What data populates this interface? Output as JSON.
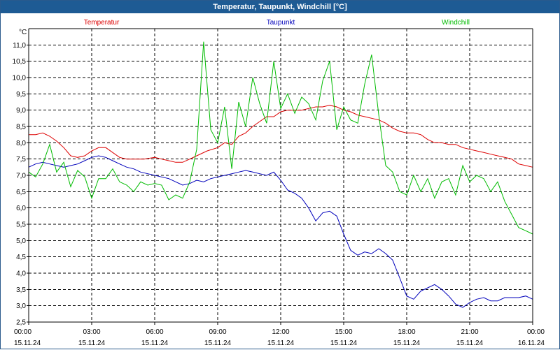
{
  "window": {
    "title": "Temperatur, Taupunkt, Windchill [°C]"
  },
  "chart_data": {
    "type": "line",
    "title": "Temperatur, Taupunkt, Windchill [°C]",
    "ylabel": "°C",
    "xlabel": "",
    "ylim": [
      2.5,
      11.5
    ],
    "xlim": [
      0,
      24
    ],
    "grid": true,
    "legend_placement": "top",
    "y_ticks": [
      "2,5",
      "3,0",
      "3,5",
      "4,0",
      "4,5",
      "5,0",
      "5,5",
      "6,0",
      "6,5",
      "7,0",
      "7,5",
      "8,0",
      "8,5",
      "9,0",
      "9,5",
      "10,0",
      "10,5",
      "11,0"
    ],
    "x_ticks": [
      {
        "time": "00:00",
        "date": "15.11.24"
      },
      {
        "time": "03:00",
        "date": "15.11.24"
      },
      {
        "time": "06:00",
        "date": "15.11.24"
      },
      {
        "time": "09:00",
        "date": "15.11.24"
      },
      {
        "time": "12:00",
        "date": "15.11.24"
      },
      {
        "time": "15:00",
        "date": "15.11.24"
      },
      {
        "time": "18:00",
        "date": "15.11.24"
      },
      {
        "time": "21:00",
        "date": "15.11.24"
      },
      {
        "time": "00:00",
        "date": "16.11.24"
      }
    ],
    "series": [
      {
        "name": "Temperatur",
        "color": "#dd0000",
        "points": [
          [
            0,
            8.25
          ],
          [
            0.33,
            8.25
          ],
          [
            0.67,
            8.3
          ],
          [
            1.0,
            8.2
          ],
          [
            1.33,
            8.05
          ],
          [
            1.67,
            7.85
          ],
          [
            2.0,
            7.6
          ],
          [
            2.33,
            7.55
          ],
          [
            2.67,
            7.6
          ],
          [
            3.0,
            7.75
          ],
          [
            3.33,
            7.85
          ],
          [
            3.67,
            7.85
          ],
          [
            4.0,
            7.7
          ],
          [
            4.33,
            7.55
          ],
          [
            4.67,
            7.5
          ],
          [
            5.0,
            7.5
          ],
          [
            5.5,
            7.5
          ],
          [
            6.0,
            7.55
          ],
          [
            6.33,
            7.5
          ],
          [
            6.67,
            7.45
          ],
          [
            7.0,
            7.4
          ],
          [
            7.33,
            7.4
          ],
          [
            7.67,
            7.5
          ],
          [
            8.0,
            7.6
          ],
          [
            8.5,
            7.75
          ],
          [
            9.0,
            7.85
          ],
          [
            9.33,
            8.0
          ],
          [
            9.67,
            7.95
          ],
          [
            10.0,
            8.2
          ],
          [
            10.33,
            8.3
          ],
          [
            10.67,
            8.5
          ],
          [
            11.0,
            8.65
          ],
          [
            11.33,
            8.8
          ],
          [
            11.67,
            8.8
          ],
          [
            12.0,
            8.95
          ],
          [
            12.33,
            9.0
          ],
          [
            12.67,
            9.0
          ],
          [
            13.0,
            9.0
          ],
          [
            13.33,
            9.05
          ],
          [
            13.67,
            9.1
          ],
          [
            14.0,
            9.1
          ],
          [
            14.33,
            9.15
          ],
          [
            14.67,
            9.1
          ],
          [
            15.0,
            9.0
          ],
          [
            15.33,
            8.95
          ],
          [
            15.67,
            8.85
          ],
          [
            16.0,
            8.8
          ],
          [
            16.33,
            8.75
          ],
          [
            16.67,
            8.7
          ],
          [
            17.0,
            8.6
          ],
          [
            17.33,
            8.45
          ],
          [
            17.67,
            8.35
          ],
          [
            18.0,
            8.3
          ],
          [
            18.33,
            8.3
          ],
          [
            18.67,
            8.25
          ],
          [
            19.0,
            8.1
          ],
          [
            19.33,
            8.0
          ],
          [
            19.67,
            8.0
          ],
          [
            20.0,
            7.95
          ],
          [
            20.33,
            7.95
          ],
          [
            20.67,
            7.85
          ],
          [
            21.0,
            7.8
          ],
          [
            21.33,
            7.75
          ],
          [
            21.67,
            7.7
          ],
          [
            22.0,
            7.65
          ],
          [
            22.33,
            7.6
          ],
          [
            22.67,
            7.55
          ],
          [
            23.0,
            7.5
          ],
          [
            23.33,
            7.35
          ],
          [
            23.67,
            7.3
          ],
          [
            24.0,
            7.25
          ]
        ]
      },
      {
        "name": "Taupunkt",
        "color": "#0000bb",
        "points": [
          [
            0,
            7.25
          ],
          [
            0.33,
            7.35
          ],
          [
            0.67,
            7.4
          ],
          [
            1.0,
            7.35
          ],
          [
            1.33,
            7.3
          ],
          [
            1.67,
            7.25
          ],
          [
            2.0,
            7.3
          ],
          [
            2.33,
            7.35
          ],
          [
            2.67,
            7.45
          ],
          [
            3.0,
            7.55
          ],
          [
            3.33,
            7.6
          ],
          [
            3.67,
            7.55
          ],
          [
            4.0,
            7.45
          ],
          [
            4.33,
            7.35
          ],
          [
            4.67,
            7.25
          ],
          [
            5.0,
            7.2
          ],
          [
            5.33,
            7.1
          ],
          [
            5.67,
            7.05
          ],
          [
            6.0,
            7.0
          ],
          [
            6.33,
            6.95
          ],
          [
            6.67,
            6.9
          ],
          [
            7.0,
            6.8
          ],
          [
            7.33,
            6.7
          ],
          [
            7.67,
            6.75
          ],
          [
            8.0,
            6.85
          ],
          [
            8.33,
            6.8
          ],
          [
            8.67,
            6.9
          ],
          [
            9.0,
            6.95
          ],
          [
            9.33,
            7.0
          ],
          [
            9.67,
            7.05
          ],
          [
            10.0,
            7.1
          ],
          [
            10.33,
            7.15
          ],
          [
            10.67,
            7.1
          ],
          [
            11.0,
            7.05
          ],
          [
            11.33,
            7.0
          ],
          [
            11.67,
            7.1
          ],
          [
            12.0,
            6.85
          ],
          [
            12.33,
            6.55
          ],
          [
            12.67,
            6.45
          ],
          [
            13.0,
            6.3
          ],
          [
            13.33,
            6.0
          ],
          [
            13.67,
            5.6
          ],
          [
            14.0,
            5.85
          ],
          [
            14.33,
            5.9
          ],
          [
            14.67,
            5.75
          ],
          [
            15.0,
            5.2
          ],
          [
            15.33,
            4.7
          ],
          [
            15.67,
            4.55
          ],
          [
            16.0,
            4.65
          ],
          [
            16.33,
            4.6
          ],
          [
            16.67,
            4.75
          ],
          [
            17.0,
            4.6
          ],
          [
            17.33,
            4.4
          ],
          [
            17.67,
            3.85
          ],
          [
            18.0,
            3.3
          ],
          [
            18.33,
            3.2
          ],
          [
            18.67,
            3.45
          ],
          [
            19.0,
            3.55
          ],
          [
            19.33,
            3.65
          ],
          [
            19.67,
            3.5
          ],
          [
            20.0,
            3.3
          ],
          [
            20.33,
            3.05
          ],
          [
            20.67,
            2.95
          ],
          [
            21.0,
            3.1
          ],
          [
            21.33,
            3.2
          ],
          [
            21.67,
            3.25
          ],
          [
            22.0,
            3.15
          ],
          [
            22.33,
            3.15
          ],
          [
            22.67,
            3.25
          ],
          [
            23.0,
            3.25
          ],
          [
            23.33,
            3.25
          ],
          [
            23.67,
            3.3
          ],
          [
            24.0,
            3.2
          ]
        ]
      },
      {
        "name": "Windchill",
        "color": "#00bb00",
        "points": [
          [
            0,
            7.1
          ],
          [
            0.33,
            6.95
          ],
          [
            0.67,
            7.35
          ],
          [
            1.0,
            7.95
          ],
          [
            1.33,
            7.1
          ],
          [
            1.67,
            7.4
          ],
          [
            2.0,
            6.65
          ],
          [
            2.33,
            7.15
          ],
          [
            2.67,
            6.95
          ],
          [
            3.0,
            6.3
          ],
          [
            3.33,
            6.9
          ],
          [
            3.67,
            6.9
          ],
          [
            4.0,
            7.2
          ],
          [
            4.33,
            6.8
          ],
          [
            4.67,
            6.7
          ],
          [
            5.0,
            6.5
          ],
          [
            5.33,
            6.8
          ],
          [
            5.67,
            6.7
          ],
          [
            6.0,
            6.75
          ],
          [
            6.33,
            6.7
          ],
          [
            6.67,
            6.25
          ],
          [
            7.0,
            6.4
          ],
          [
            7.33,
            6.3
          ],
          [
            7.67,
            6.8
          ],
          [
            8.0,
            7.8
          ],
          [
            8.33,
            11.1
          ],
          [
            8.67,
            8.4
          ],
          [
            9.0,
            8.0
          ],
          [
            9.33,
            9.1
          ],
          [
            9.67,
            7.2
          ],
          [
            10.0,
            9.25
          ],
          [
            10.33,
            8.5
          ],
          [
            10.67,
            10.0
          ],
          [
            11.0,
            9.2
          ],
          [
            11.33,
            8.6
          ],
          [
            11.67,
            10.5
          ],
          [
            12.0,
            9.05
          ],
          [
            12.33,
            9.5
          ],
          [
            12.67,
            8.9
          ],
          [
            13.0,
            9.4
          ],
          [
            13.33,
            9.2
          ],
          [
            13.67,
            8.7
          ],
          [
            14.0,
            9.9
          ],
          [
            14.33,
            10.5
          ],
          [
            14.67,
            8.4
          ],
          [
            15.0,
            9.1
          ],
          [
            15.33,
            8.7
          ],
          [
            15.67,
            8.6
          ],
          [
            16.0,
            9.8
          ],
          [
            16.33,
            10.7
          ],
          [
            16.67,
            8.85
          ],
          [
            17.0,
            7.3
          ],
          [
            17.33,
            7.1
          ],
          [
            17.67,
            6.5
          ],
          [
            18.0,
            6.4
          ],
          [
            18.33,
            7.0
          ],
          [
            18.67,
            6.5
          ],
          [
            19.0,
            6.9
          ],
          [
            19.33,
            6.3
          ],
          [
            19.67,
            6.8
          ],
          [
            20.0,
            6.9
          ],
          [
            20.33,
            6.4
          ],
          [
            20.67,
            7.3
          ],
          [
            21.0,
            6.8
          ],
          [
            21.33,
            7.0
          ],
          [
            21.67,
            6.9
          ],
          [
            22.0,
            6.5
          ],
          [
            22.33,
            6.8
          ],
          [
            22.67,
            6.2
          ],
          [
            23.0,
            5.8
          ],
          [
            23.33,
            5.4
          ],
          [
            23.67,
            5.3
          ],
          [
            24.0,
            5.2
          ]
        ]
      }
    ]
  }
}
